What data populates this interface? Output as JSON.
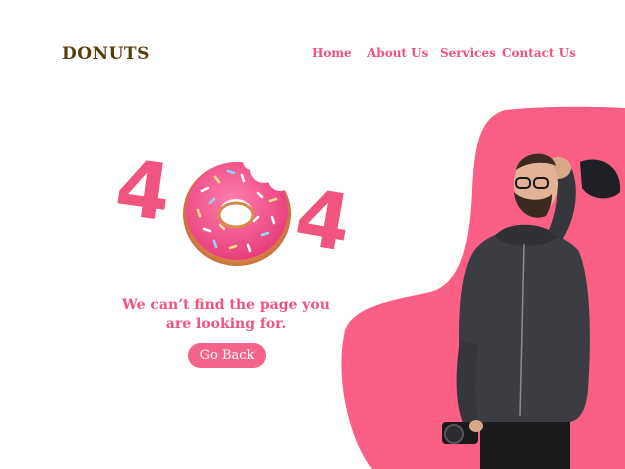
{
  "brand": {
    "logo": "DONUTS"
  },
  "nav": {
    "home": "Home",
    "about": "About Us",
    "services": "Services",
    "contact": "Contact Us"
  },
  "error": {
    "digit_left": "4",
    "digit_right": "4",
    "message": "We can’t find the page you are looking for.",
    "button": "Go Back"
  },
  "colors": {
    "accent": "#f0547e",
    "button": "#f4648a",
    "logo": "#5a3e0c",
    "background": "#ffffff"
  },
  "images": {
    "donut": "pink-sprinkled-donut-with-bite",
    "person": "man-in-dark-hoodie-with-camera-looking-up"
  }
}
